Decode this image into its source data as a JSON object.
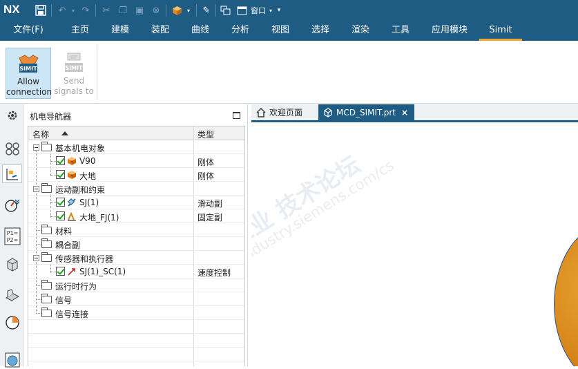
{
  "app": {
    "logo": "NX"
  },
  "quickbar": {
    "window_label": "窗口"
  },
  "menu": {
    "items": [
      "文件(F)",
      "主页",
      "建模",
      "装配",
      "曲线",
      "分析",
      "视图",
      "选择",
      "渲染",
      "工具",
      "应用模块",
      "Simit"
    ],
    "active": "Simit"
  },
  "ribbon": {
    "allow": {
      "badge": "SIMIT",
      "line1": "Allow",
      "line2": "connection"
    },
    "send": {
      "badge": "SIMIT",
      "line1": "Send",
      "line2": "signals to"
    }
  },
  "navigator": {
    "title": "机电导航器",
    "col_name": "名称",
    "col_type": "类型",
    "rows": [
      {
        "label": "基本机电对象",
        "type": ""
      },
      {
        "label": "V90",
        "type": "刚体"
      },
      {
        "label": "大地",
        "type": "刚体"
      },
      {
        "label": "运动副和约束",
        "type": ""
      },
      {
        "label": "SJ(1)",
        "type": "滑动副"
      },
      {
        "label": "大地_FJ(1)",
        "type": "固定副"
      },
      {
        "label": "材料",
        "type": ""
      },
      {
        "label": "耦合副",
        "type": ""
      },
      {
        "label": "传感器和执行器",
        "type": ""
      },
      {
        "label": "SJ(1)_SC(1)",
        "type": "速度控制"
      },
      {
        "label": "运行时行为",
        "type": ""
      },
      {
        "label": "信号",
        "type": ""
      },
      {
        "label": "信号连接",
        "type": ""
      }
    ]
  },
  "tabs": {
    "welcome": "欢迎页面",
    "part": "MCD_SIMIT.prt",
    "close": "×"
  },
  "leftbar": {
    "p1": "P1=",
    "p2": "P2="
  },
  "watermark": {
    "line1": "西门子工业  技术论坛",
    "line2": "support.industry.siemens.com/cs"
  },
  "colors": {
    "brand": "#1f5c83",
    "accent": "#f0a830",
    "check": "#19a319"
  }
}
